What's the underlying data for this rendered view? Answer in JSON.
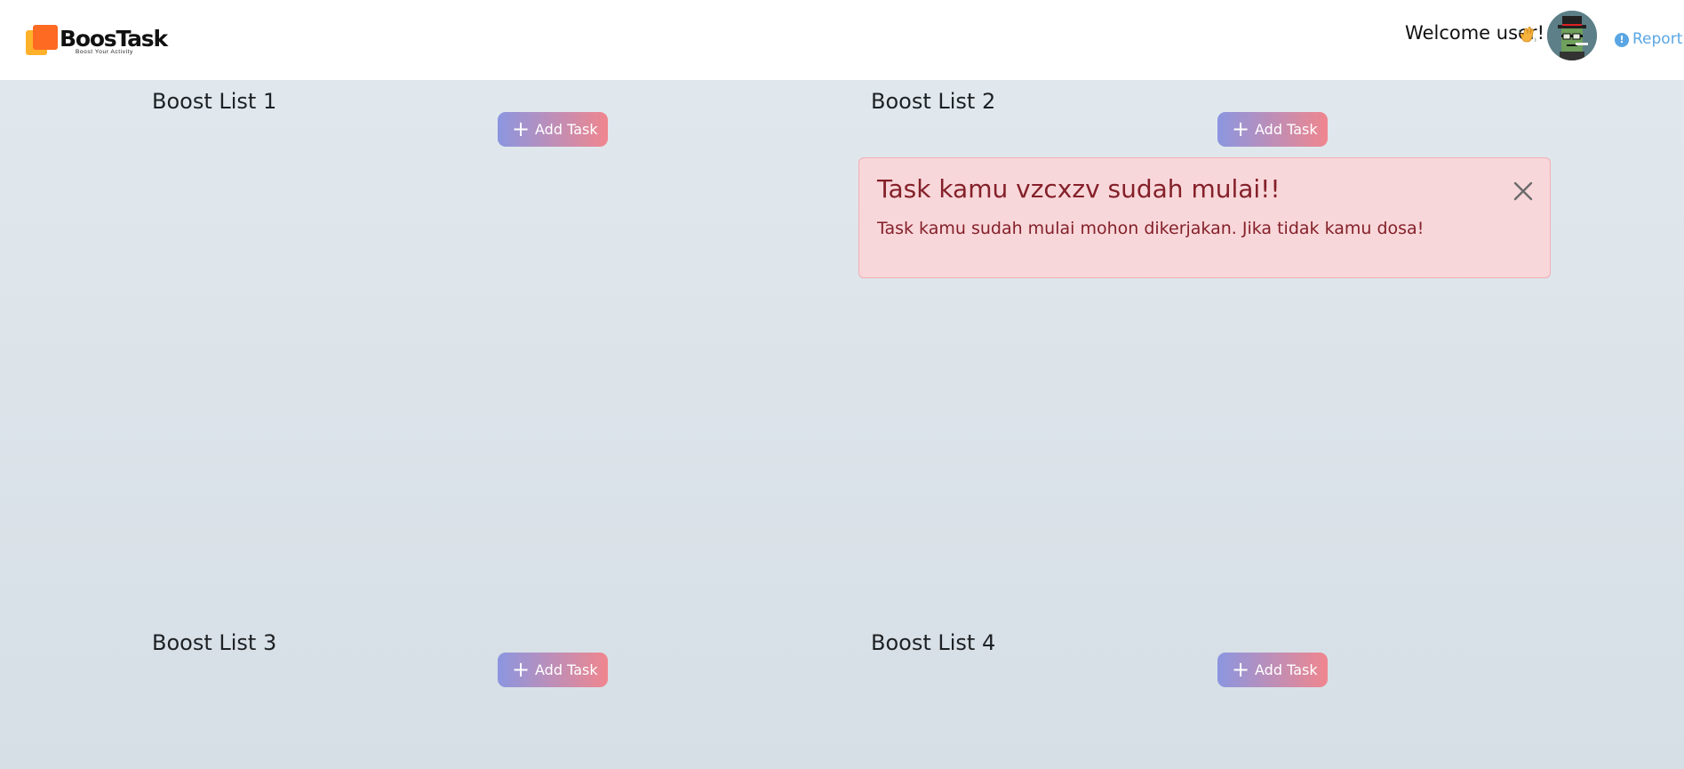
{
  "app": {
    "brand_name": "BoosTask",
    "brand_tagline": "Boost Your Activity"
  },
  "header": {
    "welcome_text": "Welcome user!",
    "report_label": "Report"
  },
  "lists": [
    {
      "title": "Boost List 1",
      "add_label": "Add Task"
    },
    {
      "title": "Boost List 2",
      "add_label": "Add Task"
    },
    {
      "title": "Boost List 3",
      "add_label": "Add Task"
    },
    {
      "title": "Boost List 4",
      "add_label": "Add Task"
    }
  ],
  "alert": {
    "title": "Task kamu vzcxzv sudah mulai!!",
    "message": "Task kamu sudah mulai mohon dikerjakan. Jika tidak kamu dosa!"
  },
  "colors": {
    "brand_orange": "#ff6a22",
    "brand_yellow": "#ffb12a",
    "button_gradient_start": "#8b96e0",
    "button_gradient_end": "#f0868e",
    "alert_bg": "#f8d7da",
    "alert_text": "#842029",
    "report_link": "#5aa6e4"
  },
  "icons": [
    "waving-hand-icon",
    "info-icon",
    "plus-icon",
    "close-icon"
  ]
}
